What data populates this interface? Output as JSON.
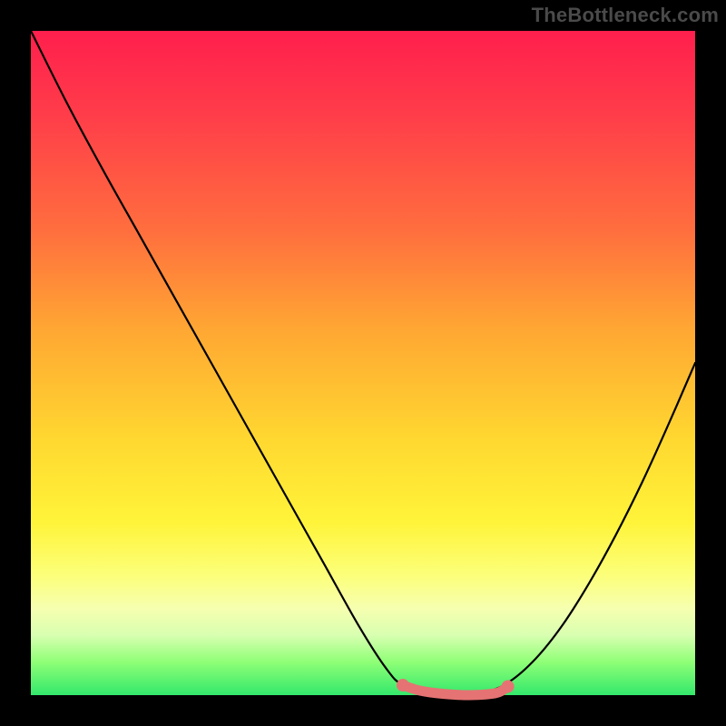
{
  "watermark": "TheBottleneck.com",
  "chart_data": {
    "type": "line",
    "title": "",
    "xlabel": "",
    "ylabel": "",
    "xlim": [
      0,
      1
    ],
    "ylim": [
      0,
      1
    ],
    "series": [
      {
        "name": "curve",
        "color": "#000000",
        "x": [
          0.0,
          0.055,
          0.11,
          0.165,
          0.22,
          0.275,
          0.33,
          0.385,
          0.44,
          0.495,
          0.535,
          0.56,
          0.6,
          0.64,
          0.68,
          0.72,
          0.76,
          0.8,
          0.84,
          0.88,
          0.92,
          0.96,
          1.0
        ],
        "y": [
          1.0,
          0.89,
          0.788,
          0.69,
          0.592,
          0.494,
          0.396,
          0.298,
          0.2,
          0.102,
          0.04,
          0.015,
          0.002,
          0.0,
          0.003,
          0.02,
          0.055,
          0.105,
          0.168,
          0.24,
          0.32,
          0.408,
          0.5
        ]
      }
    ],
    "highlight": {
      "name": "flat-region",
      "color": "#e57373",
      "stroke_width": 11,
      "x": [
        0.56,
        0.585,
        0.62,
        0.66,
        0.7,
        0.718
      ],
      "y": [
        0.015,
        0.007,
        0.002,
        0.0,
        0.003,
        0.013
      ]
    },
    "highlight_dots": {
      "name": "flat-region-endcaps",
      "color": "#e57373",
      "r": 7,
      "points": [
        {
          "x": 0.56,
          "y": 0.015
        },
        {
          "x": 0.718,
          "y": 0.013
        }
      ]
    }
  }
}
